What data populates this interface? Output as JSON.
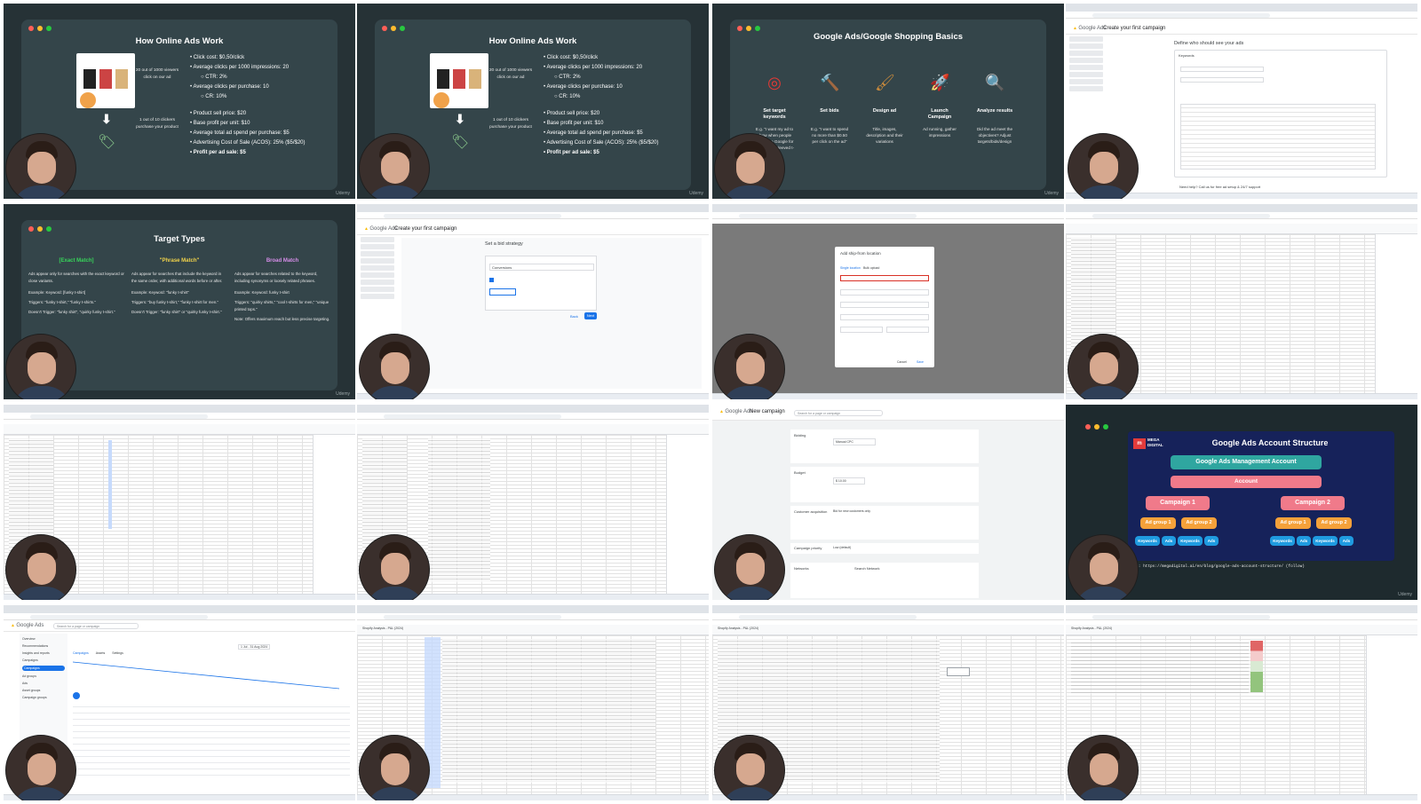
{
  "slide1": {
    "title": "How Online Ads Work",
    "note_top": "20 out of 1000 viewers click on our ad",
    "note_bottom": "1 out of 10 clickers purchase your product",
    "bullets": [
      "Click cost: $0,50/click",
      "Average clicks per 1000 impressions: 20",
      "CTR: 2%",
      "Average clicks per purchase: 10",
      "CR: 10%",
      "Product sell price: $20",
      "Base profit per unit: $10",
      "Average total ad spend per purchase: $5",
      "Advertising Cost of Sale (ACOS):  25% ($5/$20)",
      "Profit per ad sale: $5"
    ],
    "watermark": "Udemy"
  },
  "slide2": {
    "title": "Google Ads/Google Shopping Basics",
    "steps": [
      {
        "label": "Set target keywords",
        "icon": "target-icon",
        "desc": "E.g. \"I want my ad to show when people search on Google for \"funky long-sleeved t-shirts\""
      },
      {
        "label": "Set bids",
        "icon": "gavel-icon",
        "desc": "E.g. \"I want to spend no more than $0.50 per click on the ad\""
      },
      {
        "label": "Design ad",
        "icon": "paintbrush-icon",
        "desc": "Title, images, description and their variations"
      },
      {
        "label": "Launch Campaign",
        "icon": "rocket-icon",
        "desc": "Ad running, gather impressions"
      },
      {
        "label": "Analyze results",
        "icon": "magnifier-icon",
        "desc": "Did the ad meet the objectives? Adjust targets/bids/design"
      }
    ]
  },
  "ads1": {
    "app": "Google Ads",
    "page": "Create your first campaign",
    "heading": "Define who should see your ads",
    "section": "Keywords",
    "promo": "Need help? Call us for free ad setup & 24/7 support"
  },
  "target_types": {
    "title": "Target Types",
    "columns": [
      {
        "head": "[Exact Match]",
        "color": "#37d45a",
        "body": "Ads appear only for searches with the exact keyword or close variants.",
        "ex1": "Example: Keyword: [funky t-shirt]",
        "ex2": "Triggers: \"funky t-shirt,\" \"funky t-shirts.\"",
        "ex3": "Doesn't Trigger: \"funky shirt\", \"quirky funky t-shirt.\""
      },
      {
        "head": "\"Phrase Match\"",
        "color": "#f0d24a",
        "body": "Ads appear for searches that include the keyword in the same order, with additional words before or after.",
        "ex1": "Example: Keyword: \"funky t-shirt\"",
        "ex2": "Triggers: \"buy funky t-shirt,\" \"funky t-shirt for men.\"",
        "ex3": "Doesn't Trigger: \"funky shirt\" or \"quirky funky t-shirt.\""
      },
      {
        "head": "Broad Match",
        "color": "#d58de8",
        "body": "Ads appear for searches related to the keyword, including synonyms or loosely related phrases.",
        "ex1": "Example: Keyword: funky t-shirt",
        "ex2": "Triggers: \"quirky shirts,\" \"cool t-shirts for men,\" \"unique printed tops.\"",
        "ex3": "Note: Offers maximum reach but less precise targeting."
      }
    ]
  },
  "ads2": {
    "app": "Google Ads",
    "page": "Create your first campaign",
    "heading": "Set a bid strategy",
    "field": "Conversions",
    "cancel": "Back",
    "next": "Next"
  },
  "ads3": {
    "dialog_title": "Add ship-from location",
    "tab1": "Single location",
    "tab2": "Bulk upload",
    "cancel": "Cancel",
    "save": "Save"
  },
  "ads4": {
    "app": "Google Ads",
    "page": "New campaign",
    "search_placeholder": "Search for a page or campaign",
    "rows": [
      {
        "label": "Bidding",
        "value": "Manual CPC"
      },
      {
        "label": "Budget",
        "value": "$ 10.00"
      },
      {
        "label": "Customer acquisition",
        "value": "Bid for new customers only"
      },
      {
        "label": "Campaign priority",
        "value": "Low (default)"
      },
      {
        "label": "Networks",
        "value": "Search Network"
      }
    ]
  },
  "structure": {
    "brand": "MEGA DIGITAL",
    "title": "Google Ads Account Structure",
    "management": "Google Ads Management Account",
    "account": "Account",
    "campaigns": [
      "Campaign 1",
      "Campaign 2"
    ],
    "ad_groups": [
      "Ad group 1",
      "Ad group 2",
      "Ad group 1",
      "Ad group 2"
    ],
    "leaves": [
      "Keywords",
      "Ads",
      "Keywords",
      "Ads",
      "Keywords",
      "Ads",
      "Keywords",
      "Ads"
    ],
    "source": "Source: https://megadigital.ai/en/blog/google-ads-account-structure/ (follow)"
  },
  "campaigns_screen": {
    "app": "Google Ads",
    "search_placeholder": "Search for a page or campaign",
    "nav": [
      "Overview",
      "Recommendations",
      "Insights and reports",
      "Campaigns",
      "Ad groups",
      "Ads",
      "Asset groups",
      "Campaign groups"
    ],
    "tabs": [
      "Campaigns",
      "Assets",
      "Settings"
    ],
    "date": "1 Jul - 31 Aug 2024"
  },
  "sheets_title": "Shopify Analysis - P&L (2024)",
  "theme": {
    "slide_bg": "#263236",
    "card_bg": "#34454a",
    "accent_blue": "#1a73e8",
    "structure_teal": "#2fa6a0",
    "structure_pink": "#f07a8a",
    "structure_orange": "#f5a13a",
    "structure_blue": "#1f9be0"
  }
}
